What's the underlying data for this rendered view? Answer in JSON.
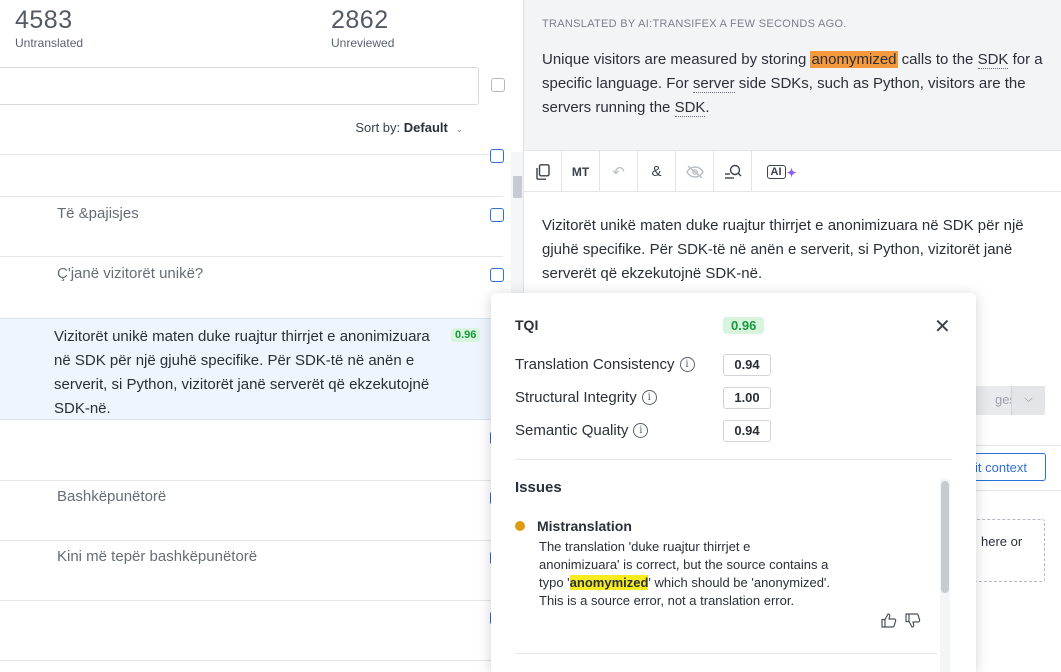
{
  "stats": [
    {
      "value": "4583",
      "label": "Untranslated"
    },
    {
      "value": "2862",
      "label": "Unreviewed"
    }
  ],
  "sort": {
    "label": "Sort by:",
    "value": "Default"
  },
  "rows": [
    {
      "source": "Të &pajisjes"
    },
    {
      "source": "Ç'janë vizitorët unikë?"
    },
    {
      "source": "Bashkëpunëtorë"
    },
    {
      "source": "Kini më tepër bashkëpunëtorë"
    }
  ],
  "selected_row": {
    "text": "Vizitorët unikë maten duke ruajtur thirrjet e anonimizuara në SDK për një gjuhë specifike. Për SDK-të në anën e serverit, si Python, vizitorët janë serverët që ekzekutojnë SDK-në.",
    "score": "0.96"
  },
  "source_panel": {
    "meta": "TRANSLATED BY AI:TRANSIFEX A FEW SECONDS AGO.",
    "part1": "Unique visitors are measured by storing ",
    "highlight": "anomymized",
    "part2": " calls to the ",
    "sdk1": "SDK",
    "part3": " for a specific language. For ",
    "server": "server",
    "part4": " side SDKs, such as Python, visitors are the servers running the ",
    "sdk2": "SDK",
    "part5": "."
  },
  "toolbar": {
    "mt_label": "MT",
    "ai_label": "AI"
  },
  "target_text": "Vizitorët unikë maten duke ruajtur thirrjet e anonimizuara në SDK për një gjuhë specifike. Për SDK-të në anën e serverit, si Python, vizitorët janë serverët që ekzekutojnë SDK-në.",
  "changes_button": "ges",
  "context_button": "it context",
  "drop_zone": "here or",
  "tqi": {
    "title": "TQI",
    "score": "0.96",
    "metrics": [
      {
        "name": "Translation Consistency",
        "value": "0.94"
      },
      {
        "name": "Structural Integrity",
        "value": "1.00"
      },
      {
        "name": "Semantic Quality",
        "value": "0.94"
      }
    ],
    "issues_heading": "Issues",
    "issue": {
      "title": "Mistranslation",
      "desc_before": "The translation 'duke ruajtur thirrjet e anonimizuara' is correct, but the source contains a typo '",
      "desc_highlight": "anomymized",
      "desc_after": "' which should be 'anonymized'. This is a source error, not a translation error."
    }
  },
  "colors": {
    "accent": "#2f6fd6",
    "score_green": "#169c3c",
    "highlight_orange": "#f59a3c",
    "highlight_yellow": "#f7ec1f",
    "issue_dot": "#e09a12"
  }
}
